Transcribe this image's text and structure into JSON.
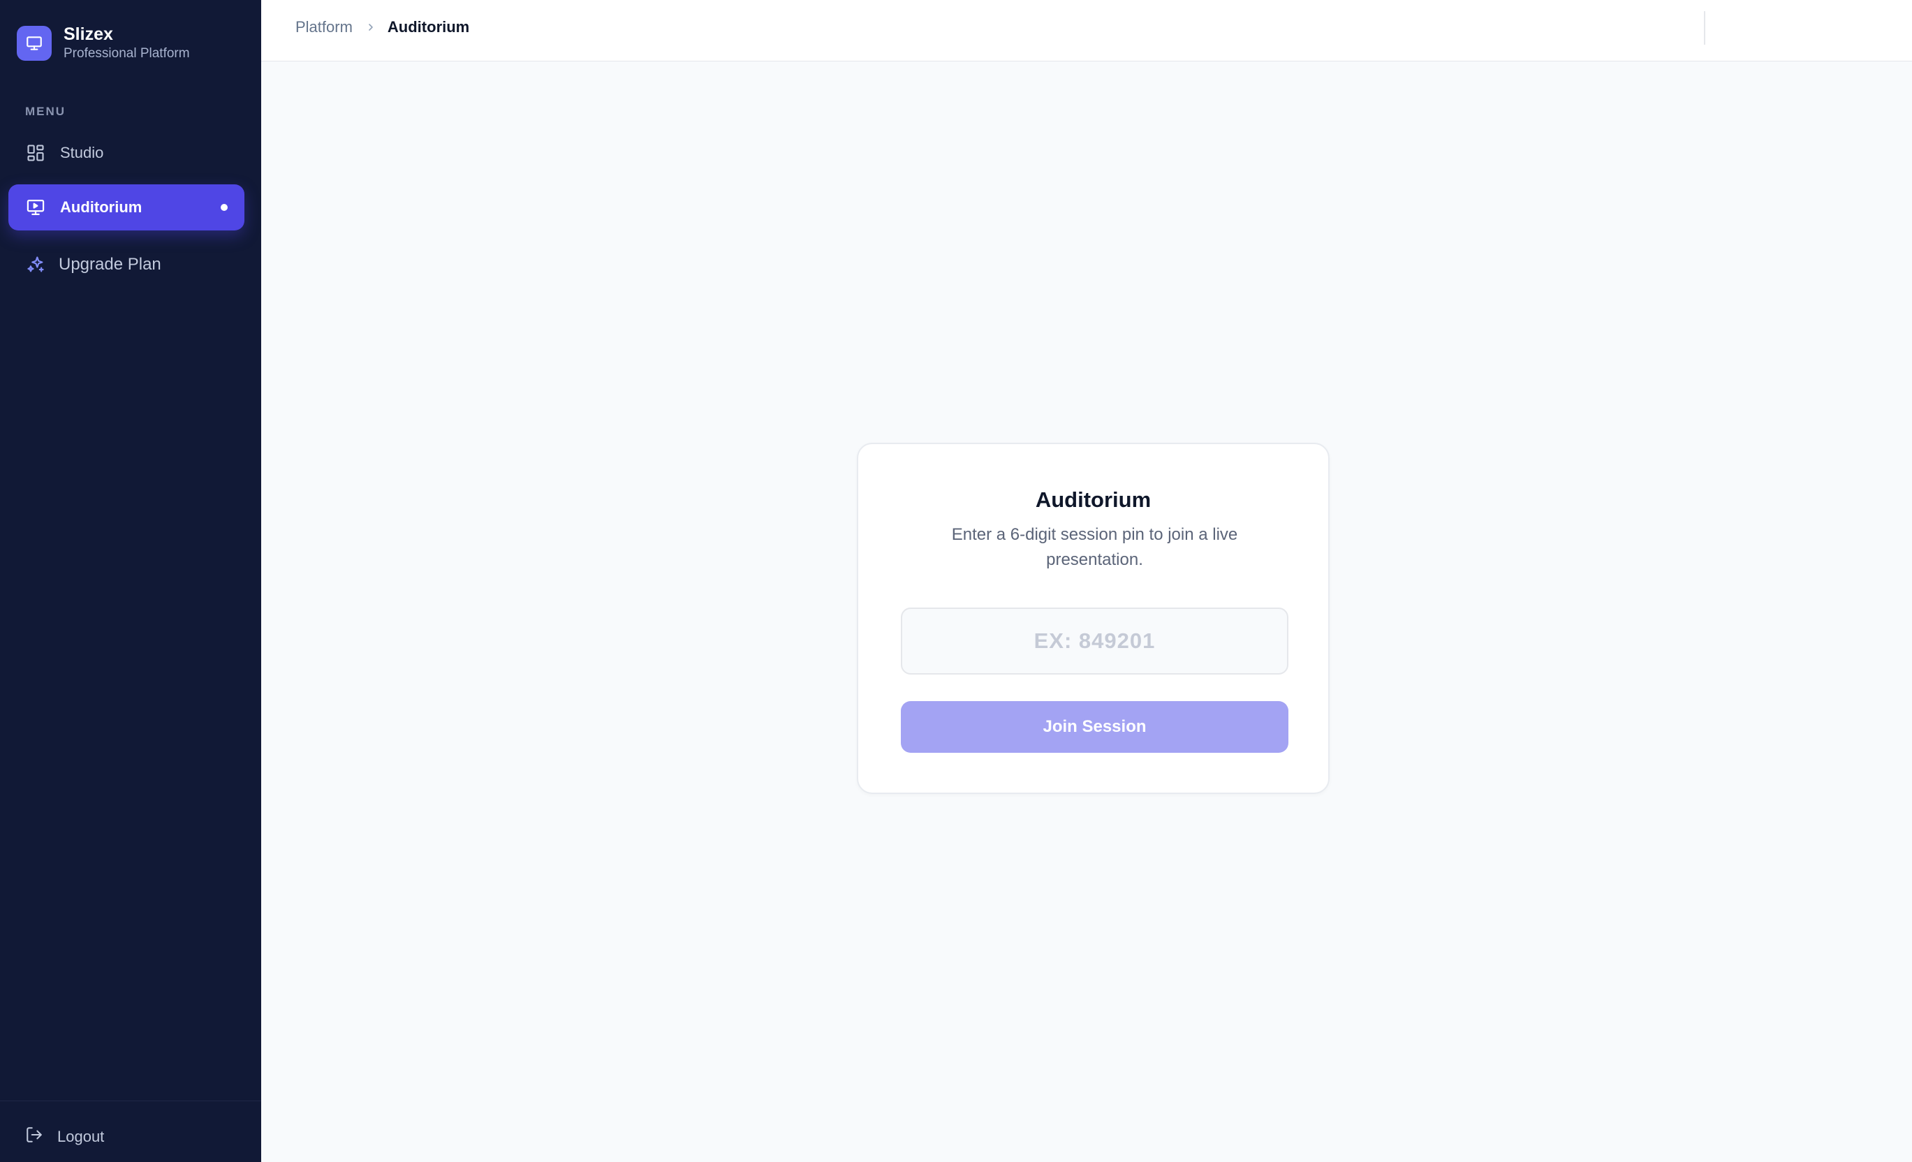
{
  "brand": {
    "name": "Slizex",
    "subtitle": "Professional Platform"
  },
  "sidebar": {
    "menu_label": "MENU",
    "items": [
      {
        "label": "Studio",
        "icon": "grid-icon",
        "active": false
      },
      {
        "label": "Auditorium",
        "icon": "monitor-play-icon",
        "active": true
      },
      {
        "label": "Upgrade Plan",
        "icon": "sparkles-icon",
        "active": false
      }
    ],
    "logout_label": "Logout"
  },
  "header": {
    "breadcrumb": {
      "root": "Platform",
      "current": "Auditorium"
    }
  },
  "card": {
    "title": "Auditorium",
    "description": "Enter a 6-digit session pin to join a live presentation.",
    "pin_placeholder": "EX: 849201",
    "pin_value": "",
    "join_label": "Join Session"
  },
  "colors": {
    "sidebar_bg": "#111936",
    "accent": "#4f46e5",
    "accent_light": "#6366f1",
    "button_disabled": "#a3a3f3",
    "page_bg": "#f8fafc"
  }
}
